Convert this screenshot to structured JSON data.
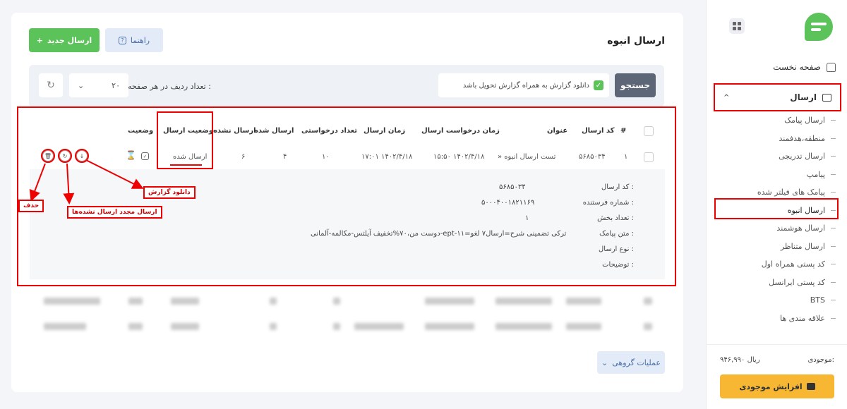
{
  "sidebar": {
    "home_label": "صفحه نخست",
    "send_label": "ارسال",
    "items": [
      {
        "label": "ارسال پیامک"
      },
      {
        "label": "منطقه،هدفمند"
      },
      {
        "label": "ارسال تدریجی"
      },
      {
        "label": "پیامپ"
      },
      {
        "label": "پیامک های فیلتر شده"
      },
      {
        "label": "ارسال انبوه"
      },
      {
        "label": "ارسال هوشمند"
      },
      {
        "label": "ارسال متناظر"
      },
      {
        "label": "کد پستی همراه اول"
      },
      {
        "label": "کد پستی ایرانسل"
      },
      {
        "label": "BTS"
      },
      {
        "label": "علاقه مندی ها"
      }
    ],
    "active_index": 5,
    "balance_label": "موجودی:",
    "balance_value": "۹۴۶,۹۹۰ ریال",
    "topup_label": "افزایش موجودی"
  },
  "header": {
    "title": "ارسال انبوه",
    "new_button": "ارسال جدید",
    "help_button": "راهنما"
  },
  "toolbar": {
    "search_button": "جستجو",
    "download_report_label": "دانلود گزارش به همراه گزارش تحویل باشد",
    "rows_per_page_label": "تعداد ردیف در هر صفحه :",
    "rows_per_page_value": "۲۰"
  },
  "table": {
    "columns": [
      "#",
      "کد ارسال",
      "عنوان",
      "زمان درخواست ارسال",
      "زمان ارسال",
      "تعداد درخواستی",
      "ارسال شده",
      "ارسال نشده",
      "وضعیت ارسال",
      "وضعیت"
    ],
    "row": {
      "index": "۱",
      "code": "۵۶۸۵۰۳۴",
      "title": "» تست ارسال انبوه",
      "request_time": "۱۵:۵۰ ۱۴۰۲/۴/۱۸",
      "send_time": "۱۷:۰۱ ۱۴۰۲/۴/۱۸",
      "requested": "۱۰",
      "sent": "۴",
      "not_sent": "۶",
      "send_status": "ارسال شده"
    }
  },
  "detail": {
    "labels": [
      "کد ارسال :",
      "شماره فرستنده :",
      "تعداد بخش :",
      "متن پیامک :",
      "نوع ارسال :",
      "توضیحات :"
    ],
    "values": [
      "۵۶۸۵۰۳۴",
      "۵۰۰۰۴۰۰۱۸۲۱۱۶۹",
      "۱",
      "دوست من،۷۰%تخفیف آیلتس-مکالمه-آلمانی-ept-ترکی تضمینی شرح=ارسال۷ لغو=۱۱",
      "",
      ""
    ]
  },
  "annotations": {
    "download_report": "دانلود گزارش",
    "resend_failed": "ارسال مجدد ارسال نشده‌ها",
    "delete": "حذف"
  },
  "footer": {
    "group_ops": "عملیات گروهی"
  },
  "colors": {
    "brand_green": "#5cc35a",
    "annotation_red": "#e00000",
    "search_button": "#5d6676",
    "topup_yellow": "#f7b733"
  }
}
